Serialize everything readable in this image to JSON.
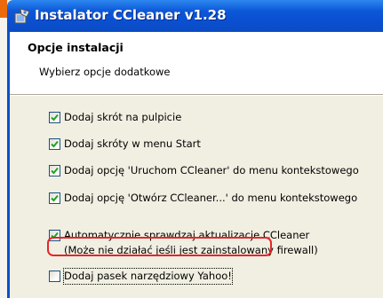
{
  "window": {
    "title": "Instalator CCleaner v1.28",
    "title_icon": "installer-app-icon"
  },
  "header": {
    "title": "Opcje instalacji",
    "subtitle": "Wybierz opcje dodatkowe"
  },
  "options": [
    {
      "label": "Dodaj skrót na pulpicie",
      "checked": true
    },
    {
      "label": "Dodaj skróty w menu Start",
      "checked": true
    },
    {
      "label": "Dodaj opcję 'Uruchom CCleaner' do menu kontekstowego",
      "checked": true
    },
    {
      "label": "Dodaj opcję 'Otwórz CCleaner...' do menu kontekstowego",
      "checked": true
    },
    {
      "label": "Automatycznie sprawdzaj aktualizacje CCleaner",
      "label_line2": "(Może nie działać jeśli jest zainstalowany firewall)",
      "checked": true
    },
    {
      "label": "Dodaj pasek narzędziowy Yahoo!",
      "checked": false,
      "highlighted": true
    }
  ],
  "colors": {
    "titlebar": "#0a4fd0",
    "highlight_ring": "#e4262a",
    "checkmark": "#21a121"
  }
}
